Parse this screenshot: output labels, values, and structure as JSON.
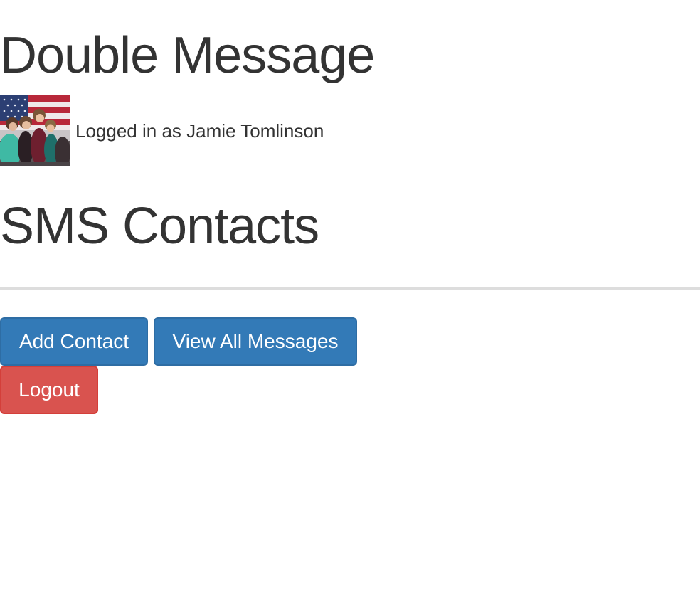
{
  "header": {
    "app_title": "Double Message"
  },
  "user": {
    "logged_in_text": "Logged in as Jamie Tomlinson",
    "avatar_alt": "Jamie Tomlinson"
  },
  "section": {
    "title": "SMS Contacts"
  },
  "actions": {
    "add_contact_label": "Add Contact",
    "view_all_messages_label": "View All Messages",
    "logout_label": "Logout"
  },
  "colors": {
    "primary": "#337ab7",
    "danger": "#d9534f",
    "text": "#333333",
    "divider": "#dddddd"
  }
}
